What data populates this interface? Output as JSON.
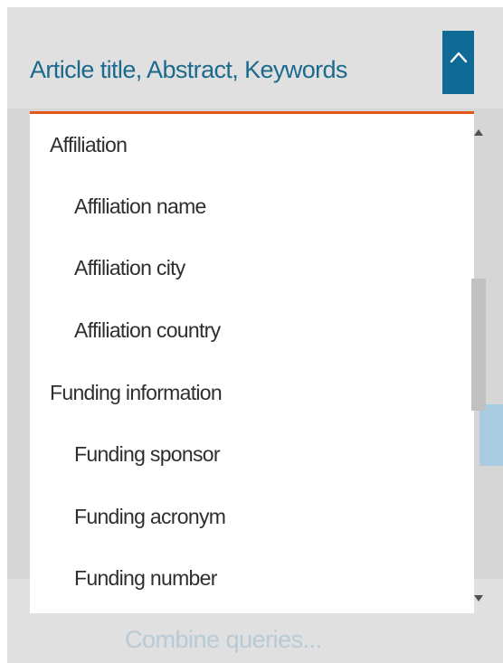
{
  "field_selector": {
    "selected_label": "Article title, Abstract, Keywords",
    "collapse_icon": "chevron-up-icon"
  },
  "options": [
    {
      "label": "Affiliation",
      "kind": "group"
    },
    {
      "label": "Affiliation name",
      "kind": "child"
    },
    {
      "label": "Affiliation city",
      "kind": "child"
    },
    {
      "label": "Affiliation country",
      "kind": "child"
    },
    {
      "label": "Funding information",
      "kind": "group"
    },
    {
      "label": "Funding sponsor",
      "kind": "child"
    },
    {
      "label": "Funding acronym",
      "kind": "child"
    },
    {
      "label": "Funding number",
      "kind": "child"
    }
  ],
  "scrollbar": {
    "up_icon": "scroll-up-arrow-icon",
    "down_icon": "scroll-down-arrow-icon"
  },
  "footer": {
    "combine_label": "Combine queries..."
  },
  "colors": {
    "accent": "#e2561b",
    "brand_blue": "#0f6b95",
    "title_text": "#1b6a8e",
    "option_text": "#2e2e2e"
  }
}
